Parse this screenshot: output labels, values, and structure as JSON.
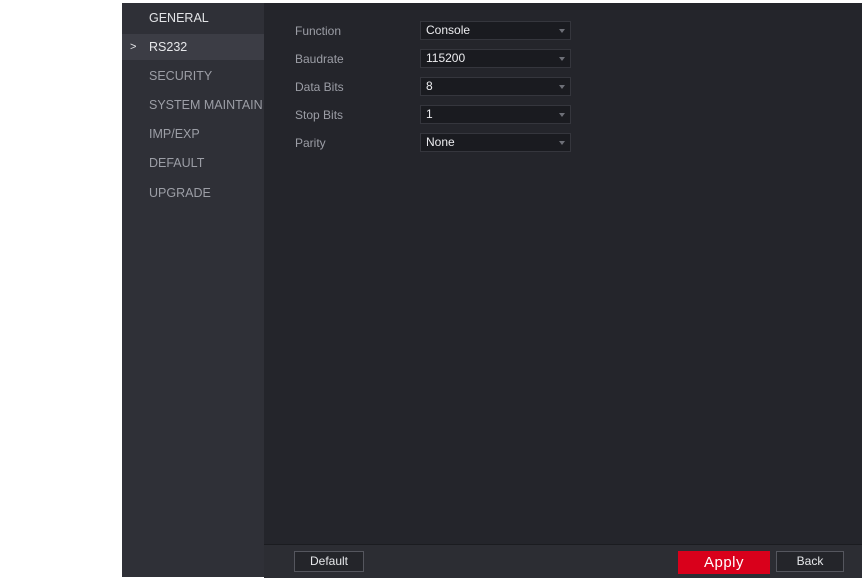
{
  "sidebar": {
    "items": [
      {
        "label": "GENERAL"
      },
      {
        "label": "RS232",
        "active": true
      },
      {
        "label": "SECURITY"
      },
      {
        "label": "SYSTEM MAINTAIN"
      },
      {
        "label": "IMP/EXP"
      },
      {
        "label": "DEFAULT"
      },
      {
        "label": "UPGRADE"
      }
    ],
    "active_indicator": ">"
  },
  "form": {
    "function": {
      "label": "Function",
      "value": "Console"
    },
    "baudrate": {
      "label": "Baudrate",
      "value": "115200"
    },
    "data_bits": {
      "label": "Data Bits",
      "value": "8"
    },
    "stop_bits": {
      "label": "Stop Bits",
      "value": "1"
    },
    "parity": {
      "label": "Parity",
      "value": "None"
    }
  },
  "footer": {
    "default_label": "Default",
    "apply_label": "Apply",
    "back_label": "Back"
  },
  "colors": {
    "accent": "#d9001b",
    "background": "#24252b",
    "sidebar": "#2f3037"
  }
}
